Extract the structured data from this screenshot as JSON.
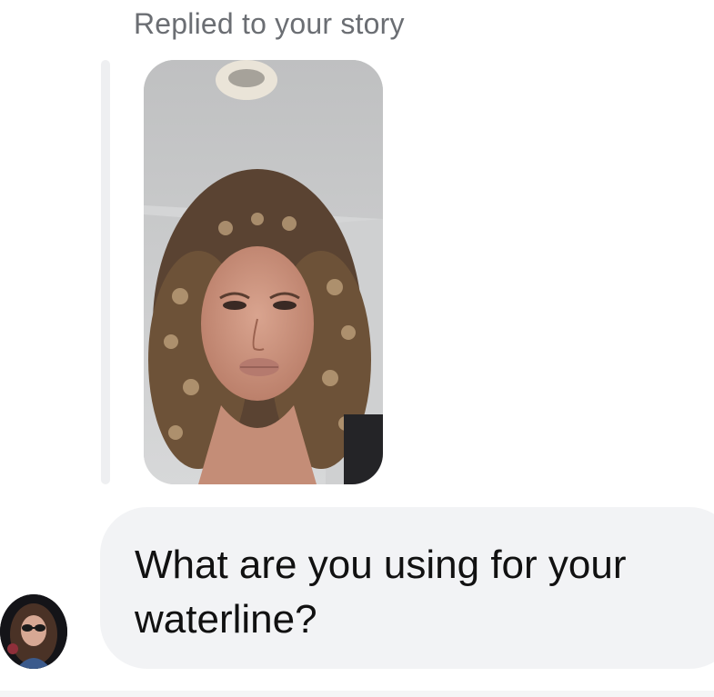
{
  "reply": {
    "caption": "Replied to your story"
  },
  "message": {
    "text": "What are you using for your waterline?"
  },
  "colors": {
    "caption": "#6b6e73",
    "bubble_background": "#f2f3f5",
    "reply_bar": "#eeeff1",
    "message_text": "#111111"
  }
}
